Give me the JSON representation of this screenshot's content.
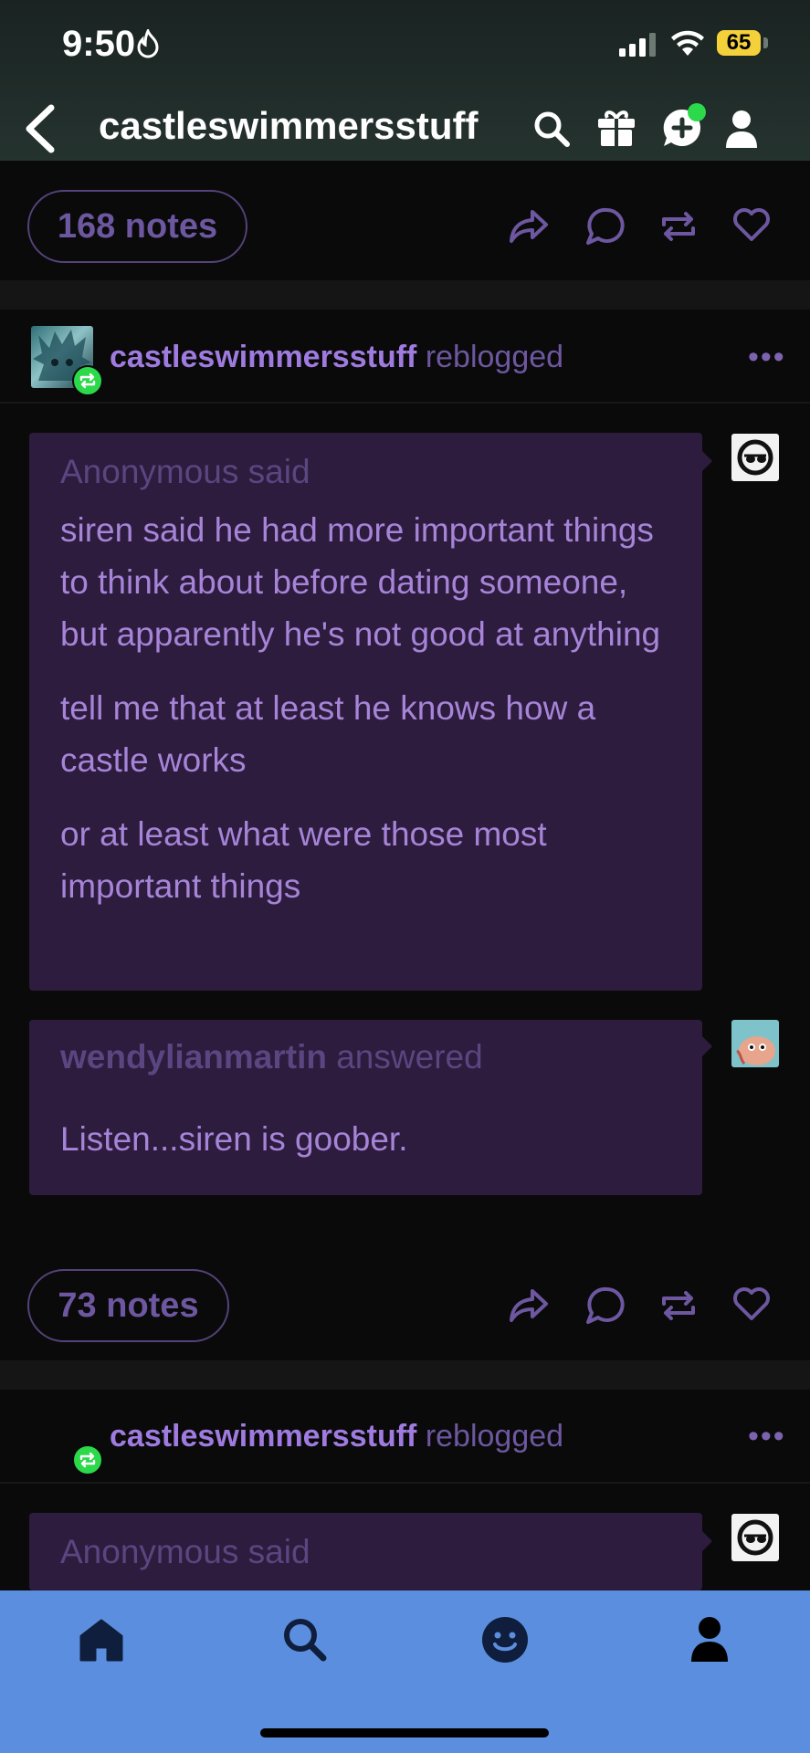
{
  "status": {
    "time": "9:50",
    "battery": "65"
  },
  "header": {
    "title": "castleswimmersstuff"
  },
  "post1": {
    "notes": "168 notes"
  },
  "post2": {
    "reblogger": "castleswimmersstuff",
    "reblogged_word": "reblogged",
    "more": "•••",
    "ask": {
      "asker": "Anonymous",
      "said": "said",
      "paragraphs": [
        "siren said he had more important things to think about before dating someone, but apparently he's not good at anything",
        "tell me that at least he knows how a castle works",
        "or at least what were those most important things"
      ]
    },
    "answer": {
      "answerer": "wendylianmartin",
      "answered": "answered",
      "text": "Listen...siren is goober."
    },
    "notes": "73 notes"
  },
  "post3": {
    "reblogger": "castleswimmersstuff",
    "reblogged_word": "reblogged",
    "more": "•••",
    "ask": {
      "asker": "Anonymous",
      "said": "said"
    }
  },
  "icons": [
    "flame-icon",
    "signal-icon",
    "wifi-icon",
    "battery-icon",
    "back-icon",
    "search-icon",
    "gift-icon",
    "chat-plus-icon",
    "user-icon",
    "share-icon",
    "comment-icon",
    "reblog-icon",
    "heart-icon",
    "more-icon",
    "home-icon",
    "explore-icon",
    "activity-icon",
    "account-icon"
  ],
  "colors": {
    "accent": "#a684d8",
    "bubble": "#2d1c3d",
    "tabbar": "#5b8ede",
    "badge": "#2bd94a"
  }
}
